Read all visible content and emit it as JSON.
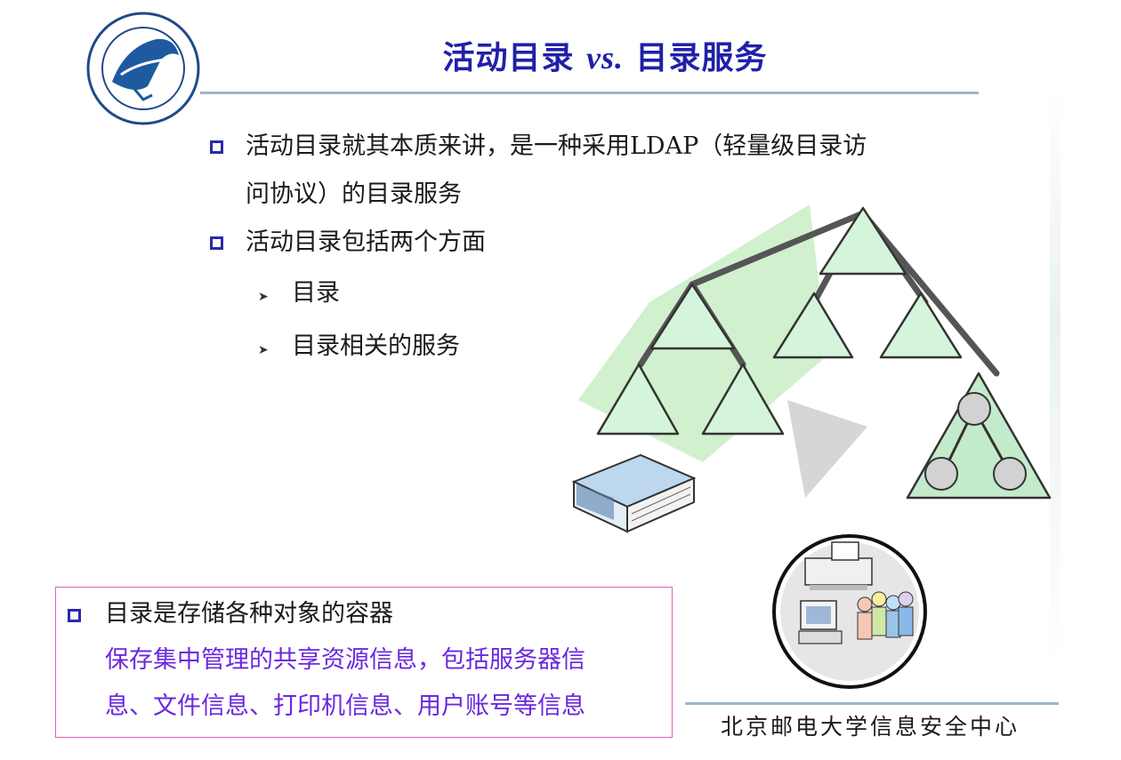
{
  "header": {
    "title_part1": "活动目录",
    "title_vs": "vs.",
    "title_part2": "目录服务"
  },
  "bullets": [
    {
      "text": "活动目录就其本质来讲，是一种采用LDAP（轻量级目录访问协议）的目录服务",
      "line1": "活动目录就其本质来讲，是一种采用LDAP（轻量级目录访",
      "line2": "问协议）的目录服务"
    },
    {
      "text": "活动目录包括两个方面",
      "sub": [
        "目录",
        "目录相关的服务"
      ]
    }
  ],
  "info_box": {
    "heading": "目录是存储各种对象的容器",
    "line1": "保存集中管理的共享资源信息，包括服务器信",
    "line2": "息、文件信息、打印机信息、用户账号等信息"
  },
  "footer": {
    "org_name": "北京邮电大学信息安全中心"
  },
  "colors": {
    "title": "#2020a8",
    "bullet_square": "#2a2aa8",
    "info_box_border": "#e060b8",
    "info_box_text": "#6a28e0",
    "rule": "#9ab8c8",
    "triangle_fill": "#d4f5dc"
  },
  "icons": [
    "university-logo",
    "tree-diagram",
    "book-icon",
    "printer-users-icon"
  ]
}
